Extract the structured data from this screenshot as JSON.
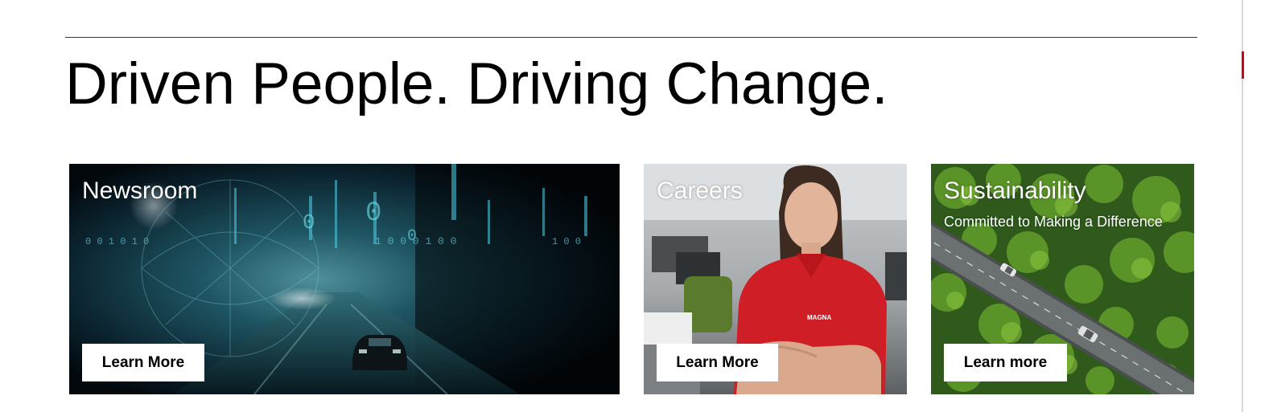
{
  "headline": "Driven People. Driving Change.",
  "colors": {
    "accent": "#d0021b",
    "rule": "#3a3a3a",
    "text": "#000000",
    "button_bg": "#ffffff"
  },
  "cards": [
    {
      "title": "Newsroom",
      "button_label": "Learn More",
      "image": "digital-tunnel-car-image"
    },
    {
      "title": "Careers",
      "button_label": "Learn More",
      "image": "employee-red-polo-office-image"
    },
    {
      "title": "Sustainability",
      "subtitle": "Committed to Making a Difference",
      "button_label": "Learn more",
      "image": "aerial-forest-road-image"
    }
  ]
}
